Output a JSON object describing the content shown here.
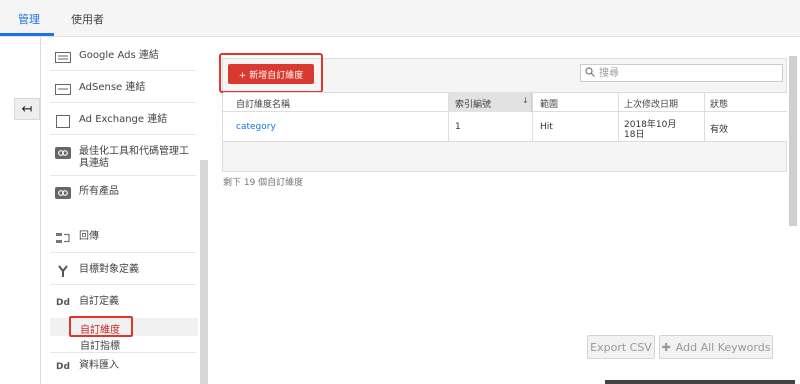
{
  "header": {
    "tabs": [
      {
        "label": "管理",
        "active": true
      },
      {
        "label": "使用者",
        "active": false
      }
    ]
  },
  "sidebar": {
    "back_icon": "arrow-left-icon",
    "items": [
      {
        "label": "Google Ads 連結",
        "icon": "google-ads-icon"
      },
      {
        "label": "AdSense 連結",
        "icon": "adsense-icon"
      },
      {
        "label": "Ad Exchange 連結",
        "icon": "ad-exchange-icon"
      },
      {
        "label": "最佳化工具和代碼管理工具連結",
        "icon": "link-icon"
      },
      {
        "label": "所有產品",
        "icon": "all-products-icon"
      },
      {
        "label": "回傳",
        "icon": "postback-icon"
      },
      {
        "label": "目標對象定義",
        "icon": "audience-icon"
      },
      {
        "label": "自訂定義",
        "icon": "dd-icon"
      },
      {
        "label": "資料匯入",
        "icon": "dd-icon"
      }
    ],
    "subitems": [
      {
        "label": "自訂維度",
        "active": true
      },
      {
        "label": "自訂指標",
        "active": false
      }
    ]
  },
  "toolbar": {
    "new_button": "+ 新增自訂維度",
    "search_placeholder": "搜尋"
  },
  "table": {
    "headers": [
      "自訂維度名稱",
      "索引編號",
      "範圍",
      "上次修改日期",
      "狀態"
    ],
    "rows": [
      {
        "name": "category",
        "index": "1",
        "scope": "Hit",
        "modified_line1": "2018年10月",
        "modified_line2": "18日",
        "status": "有效"
      }
    ]
  },
  "remaining_text": "剩下 19 個自訂維度",
  "actions": {
    "export": "Export CSV",
    "add_keywords": "Add All Keywords"
  },
  "colors": {
    "accent": "#1a73e8",
    "primary_button": "#d9392e",
    "highlight_box": "#e0362c"
  }
}
